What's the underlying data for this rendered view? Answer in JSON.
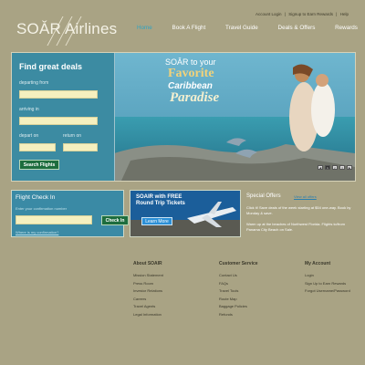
{
  "header": {
    "logo_text": "SOǍR Airlines",
    "top_links": [
      "Account Login",
      "|",
      "Signup to Earn Rewards",
      "|",
      "Help"
    ],
    "nav": [
      "Home",
      "Book A Flight",
      "Travel Guide",
      "Deals & Offers",
      "Rewards"
    ]
  },
  "hero": {
    "title": "Find great deals",
    "departing_label": "departing from",
    "arriving_label": "arriving in",
    "depart_on_label": "depart on",
    "return_on_label": "return on",
    "search_button": "Search Flights",
    "promo_line1": "SOǍR to your",
    "promo_line2": "Favorite",
    "promo_line3": "Caribbean",
    "promo_line4": "Paradise",
    "pager": [
      "◀",
      "1",
      "2",
      "3",
      "▶"
    ]
  },
  "checkin": {
    "title": "Flight Check In",
    "hint": "Enter your confirmation number",
    "button": "Check In",
    "link": "Where is my confirmation?"
  },
  "ad": {
    "line1": "SOAIR with FREE",
    "line2": "Round Trip Tickets",
    "button": "Learn More"
  },
  "specials": {
    "title": "Special Offers",
    "see_all": "View all offers",
    "p1": "Click it! Save deals of the week starting at $54 one-way. Book by Monday & save.",
    "p2": "Warm up at the beaches of Northwest Florida. Flights to/from Panama City Beach on Sale."
  },
  "footer": {
    "about": {
      "title": "About SOAIR",
      "items": [
        "Mission Statement",
        "Press Room",
        "Investor Relations",
        "Careers",
        "Travel Agents",
        "Legal Information"
      ]
    },
    "service": {
      "title": "Customer Service",
      "items": [
        "Contact Us",
        "FAQs",
        "Travel Tools",
        "Route Map",
        "Baggage Policies",
        "Refunds"
      ]
    },
    "account": {
      "title": "My Account",
      "items": [
        "Login",
        "Sign Up to Earn Rewards",
        "Forgot Username/Password"
      ]
    }
  }
}
